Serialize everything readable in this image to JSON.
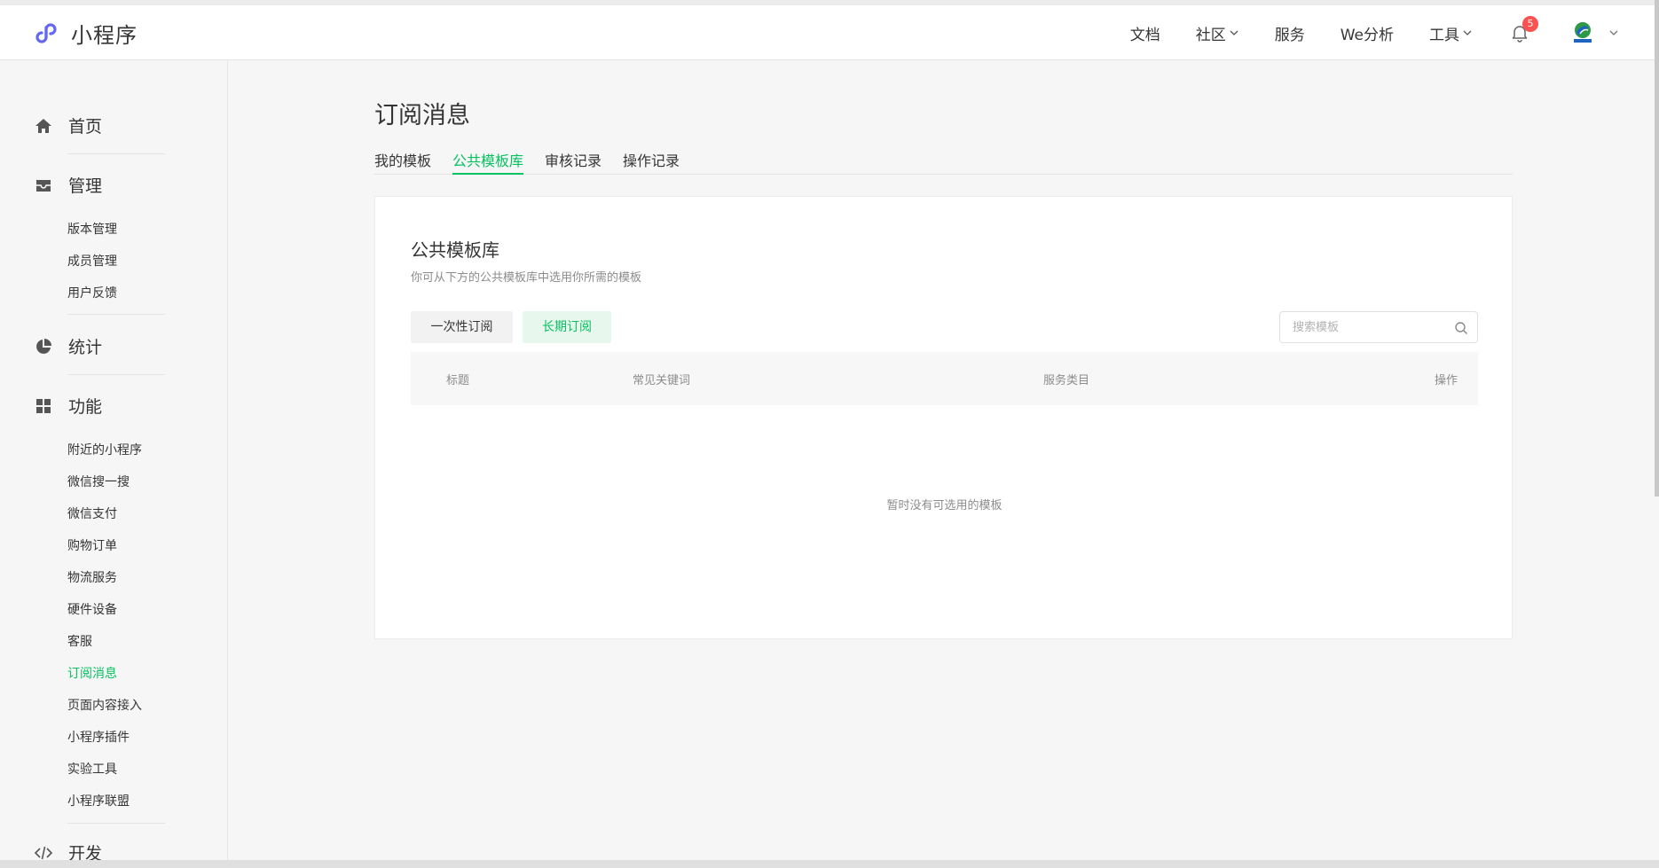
{
  "app": {
    "name": "小程序"
  },
  "header": {
    "nav": [
      {
        "label": "文档",
        "dropdown": false
      },
      {
        "label": "社区",
        "dropdown": true
      },
      {
        "label": "服务",
        "dropdown": false
      },
      {
        "label": "We分析",
        "dropdown": false
      },
      {
        "label": "工具",
        "dropdown": true
      }
    ],
    "notification_count": "5",
    "icons": {
      "logo": "miniprogram-logo-icon",
      "bell": "bell-icon",
      "avatar": "user-avatar"
    }
  },
  "sidebar": {
    "sections": [
      {
        "label": "首页",
        "icon": "home-icon"
      },
      {
        "label": "管理",
        "icon": "inbox-icon",
        "items": [
          "版本管理",
          "成员管理",
          "用户反馈"
        ]
      },
      {
        "label": "统计",
        "icon": "pie-chart-icon"
      },
      {
        "label": "功能",
        "icon": "grid-icon",
        "items": [
          "附近的小程序",
          "微信搜一搜",
          "微信支付",
          "购物订单",
          "物流服务",
          "硬件设备",
          "客服",
          "订阅消息",
          "页面内容接入",
          "小程序插件",
          "实验工具",
          "小程序联盟"
        ]
      },
      {
        "label": "开发",
        "icon": "code-icon"
      }
    ],
    "active_item": "订阅消息"
  },
  "main": {
    "title": "订阅消息",
    "tabs": [
      {
        "label": "我的模板",
        "active": false
      },
      {
        "label": "公共模板库",
        "active": true
      },
      {
        "label": "审核记录",
        "active": false
      },
      {
        "label": "操作记录",
        "active": false
      }
    ],
    "card": {
      "title": "公共模板库",
      "description": "你可从下方的公共模板库中选用你所需的模板",
      "filters": [
        {
          "label": "一次性订阅",
          "active": false
        },
        {
          "label": "长期订阅",
          "active": true
        }
      ],
      "search_placeholder": "搜索模板",
      "columns": [
        "标题",
        "常见关键词",
        "服务类目",
        "操作"
      ],
      "empty_text": "暂时没有可选用的模板"
    }
  },
  "colors": {
    "accent": "#07c160",
    "badge": "#fa5151",
    "brand": "#6467f0"
  }
}
